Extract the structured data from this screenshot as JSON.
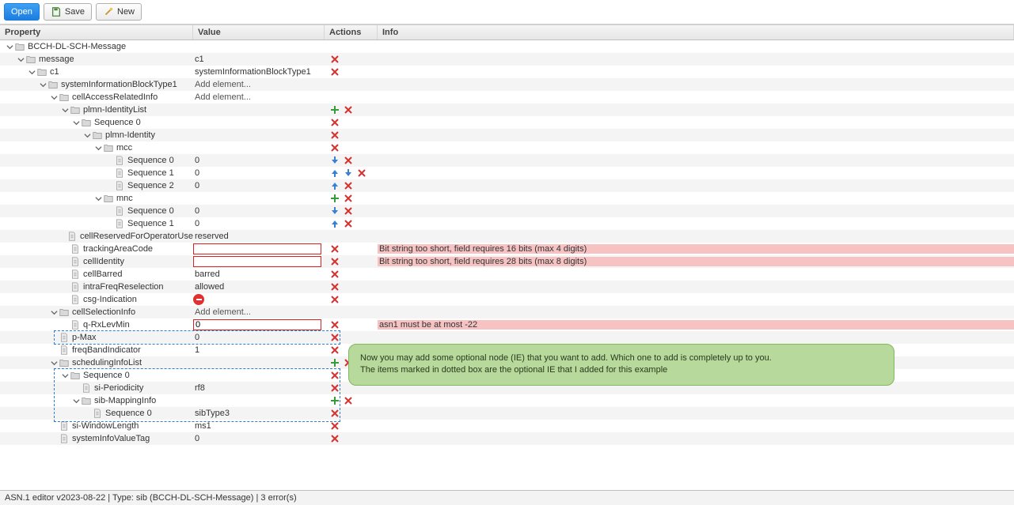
{
  "toolbar": {
    "open": "Open",
    "save": "Save",
    "new_": "New"
  },
  "columns": {
    "property": "Property",
    "value": "Value",
    "actions": "Actions",
    "info": "Info"
  },
  "rows": [
    {
      "indent": 0,
      "expand": "down",
      "icon": "folder",
      "label": "BCCH-DL-SCH-Message",
      "value": "",
      "actions": [],
      "info": ""
    },
    {
      "indent": 1,
      "expand": "down",
      "icon": "folder",
      "label": "message",
      "value": "c1",
      "actions": [
        "del"
      ],
      "info": "",
      "alt": true
    },
    {
      "indent": 2,
      "expand": "down",
      "icon": "folder",
      "label": "c1",
      "value": "systemInformationBlockType1",
      "actions": [
        "del"
      ],
      "info": ""
    },
    {
      "indent": 3,
      "expand": "down",
      "icon": "folder",
      "label": "systemInformationBlockType1",
      "value": "Add element...",
      "vlink": true,
      "actions": [],
      "info": "",
      "alt": true
    },
    {
      "indent": 4,
      "expand": "down",
      "icon": "folder",
      "label": "cellAccessRelatedInfo",
      "value": "Add element...",
      "vlink": true,
      "actions": [],
      "info": ""
    },
    {
      "indent": 5,
      "expand": "down",
      "icon": "folder",
      "label": "plmn-IdentityList",
      "value": "",
      "actions": [
        "add",
        "del"
      ],
      "info": "",
      "alt": true
    },
    {
      "indent": 6,
      "expand": "down",
      "icon": "folder",
      "label": "Sequence 0",
      "value": "",
      "actions": [
        "del"
      ],
      "info": ""
    },
    {
      "indent": 7,
      "expand": "down",
      "icon": "folder",
      "label": "plmn-Identity",
      "value": "",
      "actions": [
        "del"
      ],
      "info": "",
      "alt": true
    },
    {
      "indent": 8,
      "expand": "down",
      "icon": "folder",
      "label": "mcc",
      "value": "",
      "actions": [
        "del"
      ],
      "info": ""
    },
    {
      "indent": 9,
      "expand": "none",
      "icon": "leaf",
      "label": "Sequence 0",
      "value": "0",
      "actions": [
        "dn",
        "del"
      ],
      "info": "",
      "alt": true
    },
    {
      "indent": 9,
      "expand": "none",
      "icon": "leaf",
      "label": "Sequence 1",
      "value": "0",
      "actions": [
        "up",
        "dn",
        "del"
      ],
      "info": ""
    },
    {
      "indent": 9,
      "expand": "none",
      "icon": "leaf",
      "label": "Sequence 2",
      "value": "0",
      "actions": [
        "up",
        "del"
      ],
      "info": "",
      "alt": true
    },
    {
      "indent": 8,
      "expand": "down",
      "icon": "folder",
      "label": "mnc",
      "value": "",
      "actions": [
        "add",
        "del"
      ],
      "info": ""
    },
    {
      "indent": 9,
      "expand": "none",
      "icon": "leaf",
      "label": "Sequence 0",
      "value": "0",
      "actions": [
        "dn",
        "del"
      ],
      "info": "",
      "alt": true
    },
    {
      "indent": 9,
      "expand": "none",
      "icon": "leaf",
      "label": "Sequence 1",
      "value": "0",
      "actions": [
        "up",
        "del"
      ],
      "info": ""
    },
    {
      "indent": 7,
      "expand": "none",
      "icon": "leaf",
      "label": "cellReservedForOperatorUse",
      "value": "reserved",
      "actions": [],
      "info": "",
      "alt": true
    },
    {
      "indent": 5,
      "expand": "none",
      "icon": "leaf",
      "label": "trackingAreaCode",
      "value": "",
      "input": true,
      "actions": [
        "del"
      ],
      "info": "Bit string too short, field requires 16 bits (max 4 digits)",
      "err": true
    },
    {
      "indent": 5,
      "expand": "none",
      "icon": "leaf",
      "label": "cellIdentity",
      "value": "",
      "input": true,
      "actions": [
        "del"
      ],
      "info": "Bit string too short, field requires 28 bits (max 8 digits)",
      "err": true,
      "alt": true
    },
    {
      "indent": 5,
      "expand": "none",
      "icon": "leaf",
      "label": "cellBarred",
      "value": "barred",
      "actions": [
        "del"
      ],
      "info": ""
    },
    {
      "indent": 5,
      "expand": "none",
      "icon": "leaf",
      "label": "intraFreqReselection",
      "value": "allowed",
      "actions": [
        "del"
      ],
      "info": "",
      "alt": true
    },
    {
      "indent": 5,
      "expand": "none",
      "icon": "leaf",
      "label": "csg-Indication",
      "value": "",
      "vstop": true,
      "actions": [
        "del"
      ],
      "info": ""
    },
    {
      "indent": 4,
      "expand": "down",
      "icon": "folder",
      "label": "cellSelectionInfo",
      "value": "Add element...",
      "vlink": true,
      "actions": [],
      "info": "",
      "alt": true
    },
    {
      "indent": 5,
      "expand": "none",
      "icon": "leaf",
      "label": "q-RxLevMin",
      "value": "0",
      "input": true,
      "actions": [
        "del"
      ],
      "info": "asn1 must be at most -22",
      "err": true
    },
    {
      "indent": 4,
      "expand": "none",
      "icon": "leaf",
      "label": "p-Max",
      "value": "0",
      "actions": [
        "del"
      ],
      "info": "",
      "alt": true
    },
    {
      "indent": 4,
      "expand": "none",
      "icon": "leaf",
      "label": "freqBandIndicator",
      "value": "1",
      "actions": [
        "del"
      ],
      "info": ""
    },
    {
      "indent": 4,
      "expand": "down",
      "icon": "folder",
      "label": "schedulingInfoList",
      "value": "",
      "actions": [
        "add",
        "del"
      ],
      "info": "",
      "alt": true
    },
    {
      "indent": 5,
      "expand": "down",
      "icon": "folder",
      "label": "Sequence 0",
      "value": "",
      "actions": [
        "del"
      ],
      "info": ""
    },
    {
      "indent": 6,
      "expand": "none",
      "icon": "leaf",
      "label": "si-Periodicity",
      "value": "rf8",
      "actions": [
        "del"
      ],
      "info": "",
      "alt": true
    },
    {
      "indent": 6,
      "expand": "down",
      "icon": "folder",
      "label": "sib-MappingInfo",
      "value": "",
      "actions": [
        "add",
        "del"
      ],
      "info": ""
    },
    {
      "indent": 7,
      "expand": "none",
      "icon": "leaf",
      "label": "Sequence 0",
      "value": "sibType3",
      "actions": [
        "del"
      ],
      "info": "",
      "alt": true
    },
    {
      "indent": 4,
      "expand": "none",
      "icon": "leaf",
      "label": "si-WindowLength",
      "value": "ms1",
      "actions": [
        "del"
      ],
      "info": ""
    },
    {
      "indent": 4,
      "expand": "none",
      "icon": "leaf",
      "label": "systemInfoValueTag",
      "value": "0",
      "actions": [
        "del"
      ],
      "info": "",
      "alt": true
    }
  ],
  "callout": {
    "line1": "Now you may add some optional node (IE) that you want to add. Which one to add is completely up to you.",
    "line2": "The items marked in dotted box are the optional IE that I added for this example"
  },
  "status": "ASN.1 editor v2023-08-22 | Type: sib (BCCH-DL-SCH-Message) | 3 error(s)"
}
